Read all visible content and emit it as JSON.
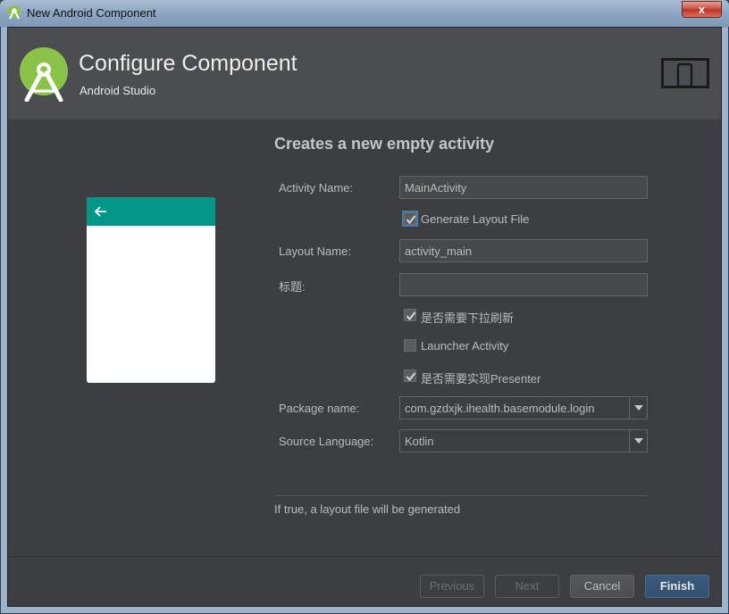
{
  "window": {
    "title": "New Android Component",
    "close_label": "x"
  },
  "header": {
    "title": "Configure Component",
    "subtitle": "Android Studio"
  },
  "form": {
    "heading": "Creates a new empty activity",
    "activity_name": {
      "label": "Activity Name:",
      "value": "MainActivity"
    },
    "generate_layout": {
      "label": "Generate Layout File",
      "checked": true
    },
    "layout_name": {
      "label": "Layout Name:",
      "value": "activity_main"
    },
    "title_field": {
      "label": "标题:",
      "value": ""
    },
    "pull_refresh": {
      "label": "是否需要下拉刷新",
      "checked": true
    },
    "launcher_activity": {
      "label": "Launcher Activity",
      "checked": false
    },
    "presenter": {
      "label": "是否需要实现Presenter",
      "checked": true
    },
    "package_name": {
      "label": "Package name:",
      "value": "com.gzdxjk.ihealth.basemodule.login"
    },
    "source_language": {
      "label": "Source Language:",
      "value": "Kotlin"
    },
    "hint": "If true, a layout file will be generated"
  },
  "buttons": {
    "previous": "Previous",
    "next": "Next",
    "cancel": "Cancel",
    "finish": "Finish"
  },
  "colors": {
    "accent": "#009688",
    "background": "#3c3f41",
    "header": "#4b4d4f",
    "android_green": "#8bc34a"
  }
}
